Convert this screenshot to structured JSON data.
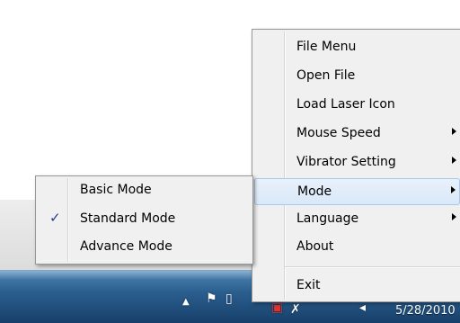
{
  "main_menu": {
    "items": [
      {
        "label": "File Menu",
        "submenu": false
      },
      {
        "label": "Open File",
        "submenu": false
      },
      {
        "label": "Load Laser Icon",
        "submenu": false
      },
      {
        "label": "Mouse Speed",
        "submenu": true
      },
      {
        "label": "Vibrator Setting",
        "submenu": true
      },
      {
        "label": "Mode",
        "submenu": true,
        "highlighted": true
      },
      {
        "label": "Language",
        "submenu": true
      },
      {
        "label": "About",
        "submenu": false
      },
      {
        "label": "Exit",
        "submenu": false
      }
    ]
  },
  "mode_submenu": {
    "items": [
      {
        "label": "Basic Mode",
        "checked": false
      },
      {
        "label": "Standard Mode",
        "checked": true
      },
      {
        "label": "Advance Mode",
        "checked": false
      }
    ],
    "check_glyph": "✓"
  },
  "taskbar": {
    "clock_date": "5/28/2010",
    "tray_icons": [
      "show-hidden-icons-arrow",
      "action-center-flag-icon",
      "device-icon",
      "network-icon",
      "tool-icon",
      "volume-icon"
    ],
    "tray_glyphs": {
      "arrow": "▲",
      "flag": "⚑",
      "device": "▯",
      "network": "▣",
      "tool": "✗",
      "volume": "◂"
    }
  },
  "colors": {
    "menu_bg": "#f0f0f0",
    "highlight": "#d9e8f8",
    "taskbar": "#2b5f8f"
  }
}
